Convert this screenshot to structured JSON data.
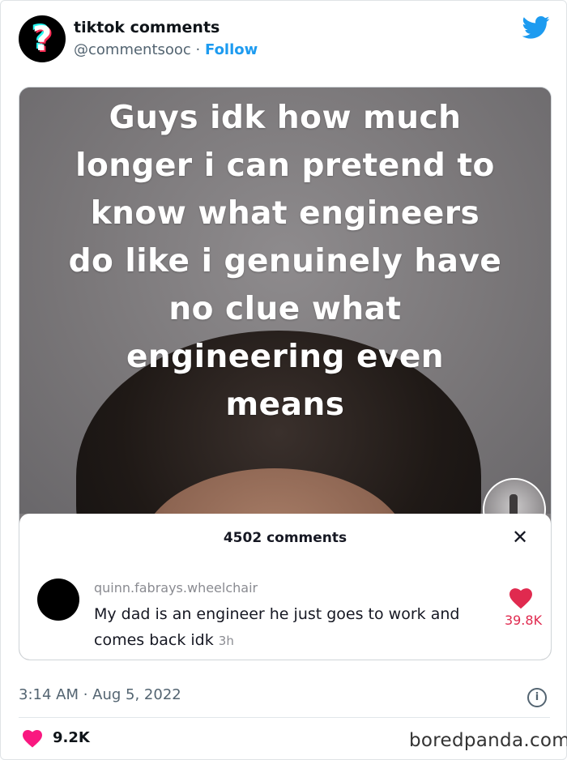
{
  "tweet": {
    "display_name": "tiktok comments",
    "handle": "@commentsooc",
    "separator": " · ",
    "follow_label": "Follow",
    "timestamp": "3:14 AM · Aug 5, 2022",
    "like_count": "9.2K",
    "info_glyph": "i"
  },
  "media": {
    "caption": "Guys idk how much longer i can pretend to know what engineers do like i genuinely have no clue what engineering even means",
    "comments_panel": {
      "count_label": "4502 comments",
      "close_glyph": "✕",
      "comment": {
        "username": "quinn.fabrays.wheelchair",
        "text": "My dad is an engineer he just goes to work and comes back idk",
        "time": "3h",
        "likes": "39.8K"
      }
    }
  },
  "watermark": "boredpanda.com",
  "colors": {
    "twitter_blue": "#1d9bf0",
    "tiktok_cyan": "#25f4ee",
    "tiktok_red": "#fe2c55",
    "heart_red": "#f91880",
    "comment_like_red": "#e02a4f"
  },
  "icons": {
    "avatar": "question-mark-logo",
    "brand": "twitter-bird-icon",
    "close": "close-icon",
    "comment_like": "heart-icon",
    "tweet_like": "heart-icon",
    "info": "info-icon"
  }
}
